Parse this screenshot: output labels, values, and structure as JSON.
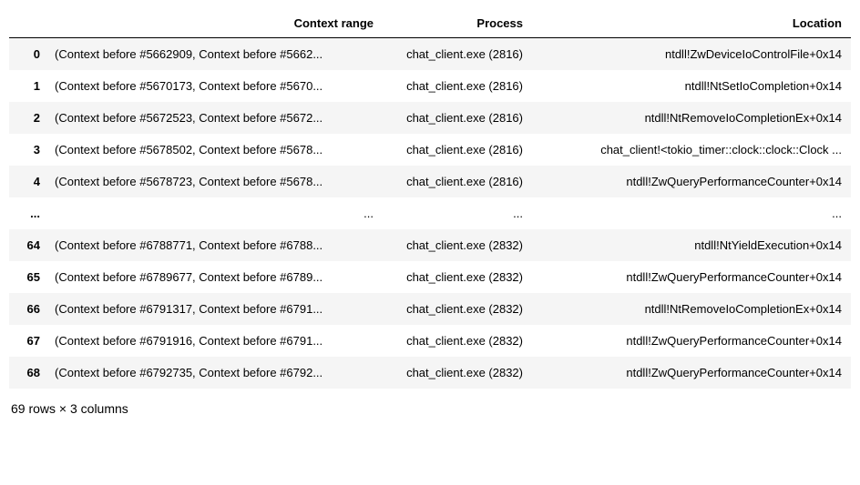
{
  "columns": [
    "Context range",
    "Process",
    "Location"
  ],
  "rows": [
    {
      "index": "0",
      "context": "(Context before #5662909, Context before #5662...",
      "process": "chat_client.exe (2816)",
      "location": "ntdll!ZwDeviceIoControlFile+0x14"
    },
    {
      "index": "1",
      "context": "(Context before #5670173, Context before #5670...",
      "process": "chat_client.exe (2816)",
      "location": "ntdll!NtSetIoCompletion+0x14"
    },
    {
      "index": "2",
      "context": "(Context before #5672523, Context before #5672...",
      "process": "chat_client.exe (2816)",
      "location": "ntdll!NtRemoveIoCompletionEx+0x14"
    },
    {
      "index": "3",
      "context": "(Context before #5678502, Context before #5678...",
      "process": "chat_client.exe (2816)",
      "location": "chat_client!<tokio_timer::clock::clock::Clock ..."
    },
    {
      "index": "4",
      "context": "(Context before #5678723, Context before #5678...",
      "process": "chat_client.exe (2816)",
      "location": "ntdll!ZwQueryPerformanceCounter+0x14"
    },
    {
      "index": "...",
      "context": "...",
      "process": "...",
      "location": "..."
    },
    {
      "index": "64",
      "context": "(Context before #6788771, Context before #6788...",
      "process": "chat_client.exe (2832)",
      "location": "ntdll!NtYieldExecution+0x14"
    },
    {
      "index": "65",
      "context": "(Context before #6789677, Context before #6789...",
      "process": "chat_client.exe (2832)",
      "location": "ntdll!ZwQueryPerformanceCounter+0x14"
    },
    {
      "index": "66",
      "context": "(Context before #6791317, Context before #6791...",
      "process": "chat_client.exe (2832)",
      "location": "ntdll!NtRemoveIoCompletionEx+0x14"
    },
    {
      "index": "67",
      "context": "(Context before #6791916, Context before #6791...",
      "process": "chat_client.exe (2832)",
      "location": "ntdll!ZwQueryPerformanceCounter+0x14"
    },
    {
      "index": "68",
      "context": "(Context before #6792735, Context before #6792...",
      "process": "chat_client.exe (2832)",
      "location": "ntdll!ZwQueryPerformanceCounter+0x14"
    }
  ],
  "summary": "69 rows × 3 columns"
}
